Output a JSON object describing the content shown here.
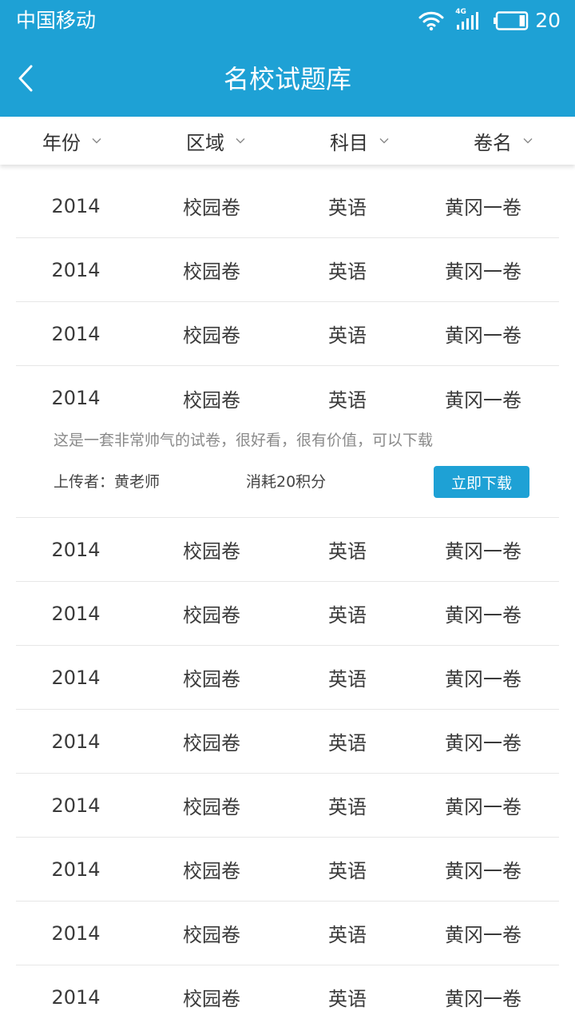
{
  "status_bar": {
    "carrier": "中国移动",
    "network_label": "4G",
    "battery": "20",
    "battery_level": 0.2,
    "icons": [
      "wifi-icon",
      "signal-icon",
      "battery-icon"
    ]
  },
  "nav": {
    "back_icon": "chevron-left-icon",
    "title": "名校试题库"
  },
  "filters": [
    {
      "label": "年份",
      "icon": "chevron-down-icon"
    },
    {
      "label": "区域",
      "icon": "chevron-down-icon"
    },
    {
      "label": "科目",
      "icon": "chevron-down-icon"
    },
    {
      "label": "卷名",
      "icon": "chevron-down-icon"
    }
  ],
  "rows": [
    {
      "year": "2014",
      "region": "校园卷",
      "subject": "英语",
      "name": "黄冈一卷"
    },
    {
      "year": "2014",
      "region": "校园卷",
      "subject": "英语",
      "name": "黄冈一卷"
    },
    {
      "year": "2014",
      "region": "校园卷",
      "subject": "英语",
      "name": "黄冈一卷"
    },
    {
      "year": "2014",
      "region": "校园卷",
      "subject": "英语",
      "name": "黄冈一卷"
    },
    {
      "year": "2014",
      "region": "校园卷",
      "subject": "英语",
      "name": "黄冈一卷"
    },
    {
      "year": "2014",
      "region": "校园卷",
      "subject": "英语",
      "name": "黄冈一卷"
    },
    {
      "year": "2014",
      "region": "校园卷",
      "subject": "英语",
      "name": "黄冈一卷"
    },
    {
      "year": "2014",
      "region": "校园卷",
      "subject": "英语",
      "name": "黄冈一卷"
    },
    {
      "year": "2014",
      "region": "校园卷",
      "subject": "英语",
      "name": "黄冈一卷"
    },
    {
      "year": "2014",
      "region": "校园卷",
      "subject": "英语",
      "name": "黄冈一卷"
    },
    {
      "year": "2014",
      "region": "校园卷",
      "subject": "英语",
      "name": "黄冈一卷"
    },
    {
      "year": "2014",
      "region": "校园卷",
      "subject": "英语",
      "name": "黄冈一卷"
    }
  ],
  "expanded": {
    "description": "这是一套非常帅气的试卷，很好看，很有价值，可以下载",
    "uploader": "上传者：黄老师",
    "cost": "消耗20积分",
    "download_label": "立即下载"
  },
  "colors": {
    "accent": "#1ea1d5",
    "divider": "#e7e7e7"
  }
}
